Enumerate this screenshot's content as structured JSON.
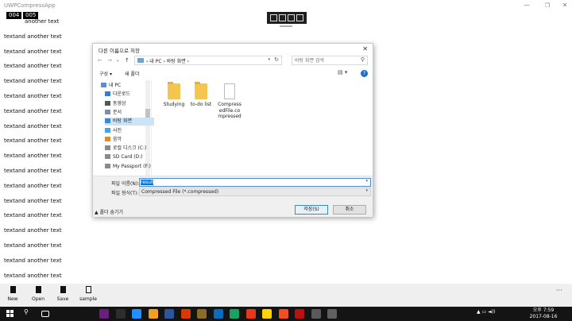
{
  "app": {
    "title": "UWPCompressApp",
    "window_min": "—",
    "window_max": "❐",
    "window_close": "✕"
  },
  "counters": [
    "004",
    "005"
  ],
  "text_list": [
    "another text",
    "textand another text",
    "textand another text",
    "textand another text",
    "textand another text",
    "textand another text",
    "textand another text",
    "textand another text",
    "textand another text",
    "textand another text",
    "textand another text",
    "textand another text",
    "textand another text",
    "textand another text",
    "textand another text",
    "textand another text",
    "textand another text",
    "textand another text",
    "textand another text"
  ],
  "dialog": {
    "title": "다른 이름으로 저장",
    "close": "✕",
    "address": "› 내 PC › 바탕 화면 ›",
    "search_placeholder": "바탕 화면 검색",
    "organize": "구성 ▾",
    "new_folder": "새 폴더",
    "view": "▤ ▾",
    "help": "?",
    "tree": [
      {
        "label": "내 PC",
        "color": "#5a8fd0",
        "selected": false
      },
      {
        "label": "다운로드",
        "color": "#3a7cc8",
        "selected": false
      },
      {
        "label": "동영상",
        "color": "#555555",
        "selected": false
      },
      {
        "label": "문서",
        "color": "#7b8fa8",
        "selected": false
      },
      {
        "label": "바탕 화면",
        "color": "#3d86d0",
        "selected": true
      },
      {
        "label": "사진",
        "color": "#4aa3df",
        "selected": false
      },
      {
        "label": "음악",
        "color": "#e08b2d",
        "selected": false
      },
      {
        "label": "로컬 디스크 (C:)",
        "color": "#8a8a8a",
        "selected": false
      },
      {
        "label": "SD Card (D:)",
        "color": "#8a8a8a",
        "selected": false
      },
      {
        "label": "My Passport (F:)",
        "color": "#8a8a8a",
        "selected": false
      }
    ],
    "files": [
      {
        "name": "Studying",
        "type": "folder"
      },
      {
        "name": "to-do list",
        "type": "folder"
      },
      {
        "name": "CompressedFile.compressed",
        "type": "file"
      }
    ],
    "filename_label": "파일 이름(N):",
    "filename_value": "result",
    "filetype_label": "파일 형식(T):",
    "filetype_value": "Compressed File (*.compressed)",
    "hide_folders": "▲ 폴더 숨기기",
    "save": "저장(S)",
    "cancel": "취소"
  },
  "appbar": {
    "new": "New",
    "open": "Open",
    "save": "Save",
    "sample": "sample",
    "more": "···"
  },
  "taskbar": {
    "clock_time": "오후 7:59",
    "clock_date": "2017-08-16",
    "icon_colors": [
      "#68217a",
      "#2d2d2d",
      "#1e90ff",
      "#f0a020",
      "#2b579a",
      "#d83b01",
      "#8b6b2a",
      "#0b6cbb",
      "#1aa260",
      "#e5391c",
      "#ffd400",
      "#f25022",
      "#b51212",
      "#5a5a5a",
      "#606060"
    ]
  }
}
